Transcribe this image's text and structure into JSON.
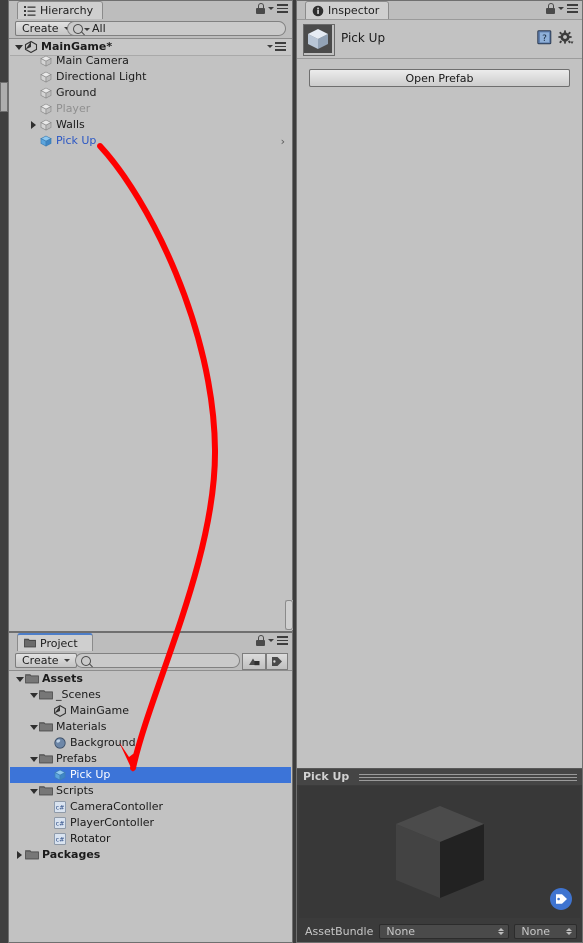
{
  "app": {
    "name": "Unity Editor",
    "accent": "#3c74d8",
    "annotation_color": "#fe0000"
  },
  "hierarchy": {
    "tab_label": "Hierarchy",
    "tab_icon": "hierarchy-icon",
    "create_label": "Create",
    "search_value": "All",
    "search_placeholder": "",
    "scene": {
      "name": "MainGame*",
      "icon": "unity-scene-icon",
      "expanded": true
    },
    "items": [
      {
        "label": "Main Camera",
        "icon": "gameobject-icon",
        "indent": 1,
        "expandable": false,
        "expanded": false,
        "state": "normal",
        "selected": false,
        "has_chevron": false
      },
      {
        "label": "Directional Light",
        "icon": "gameobject-icon",
        "indent": 1,
        "expandable": false,
        "expanded": false,
        "state": "normal",
        "selected": false,
        "has_chevron": false
      },
      {
        "label": "Ground",
        "icon": "gameobject-icon",
        "indent": 1,
        "expandable": false,
        "expanded": false,
        "state": "normal",
        "selected": false,
        "has_chevron": false
      },
      {
        "label": "Player",
        "icon": "gameobject-icon",
        "indent": 1,
        "expandable": false,
        "expanded": false,
        "state": "disabled",
        "selected": false,
        "has_chevron": false
      },
      {
        "label": "Walls",
        "icon": "gameobject-icon",
        "indent": 1,
        "expandable": true,
        "expanded": false,
        "state": "normal",
        "selected": false,
        "has_chevron": false
      },
      {
        "label": "Pick Up",
        "icon": "prefab-icon",
        "indent": 1,
        "expandable": false,
        "expanded": false,
        "state": "prefab",
        "selected": false,
        "has_chevron": true
      }
    ]
  },
  "inspector": {
    "tab_label": "Inspector",
    "tab_icon": "info-icon",
    "object_name": "Pick Up",
    "object_icon": "prefab-cube-thumbnail",
    "help_icon": "help-book-icon",
    "settings_icon": "gear-icon",
    "open_prefab_label": "Open Prefab"
  },
  "project": {
    "tab_label": "Project",
    "tab_icon": "folder-icon",
    "create_label": "Create",
    "search_value": "",
    "search_placeholder": "",
    "filter_type_icon": "filter-by-type-icon",
    "filter_label_icon": "filter-by-label-icon",
    "items": [
      {
        "label": "Assets",
        "icon": "folder-icon",
        "indent": 0,
        "expandable": true,
        "expanded": true,
        "bold": true,
        "selected": false
      },
      {
        "label": "_Scenes",
        "icon": "folder-icon",
        "indent": 1,
        "expandable": true,
        "expanded": true,
        "bold": false,
        "selected": false
      },
      {
        "label": "MainGame",
        "icon": "scene-icon",
        "indent": 2,
        "expandable": false,
        "expanded": false,
        "bold": false,
        "selected": false
      },
      {
        "label": "Materials",
        "icon": "folder-icon",
        "indent": 1,
        "expandable": true,
        "expanded": true,
        "bold": false,
        "selected": false
      },
      {
        "label": "Background",
        "icon": "material-icon",
        "indent": 2,
        "expandable": false,
        "expanded": false,
        "bold": false,
        "selected": false
      },
      {
        "label": "Prefabs",
        "icon": "folder-icon",
        "indent": 1,
        "expandable": true,
        "expanded": true,
        "bold": false,
        "selected": false
      },
      {
        "label": "Pick Up",
        "icon": "prefab-icon",
        "indent": 2,
        "expandable": false,
        "expanded": false,
        "bold": false,
        "selected": true
      },
      {
        "label": "Scripts",
        "icon": "folder-icon",
        "indent": 1,
        "expandable": true,
        "expanded": true,
        "bold": false,
        "selected": false
      },
      {
        "label": "CameraContoller",
        "icon": "csharp-script-icon",
        "indent": 2,
        "expandable": false,
        "expanded": false,
        "bold": false,
        "selected": false
      },
      {
        "label": "PlayerContoller",
        "icon": "csharp-script-icon",
        "indent": 2,
        "expandable": false,
        "expanded": false,
        "bold": false,
        "selected": false
      },
      {
        "label": "Rotator",
        "icon": "csharp-script-icon",
        "indent": 2,
        "expandable": false,
        "expanded": false,
        "bold": false,
        "selected": false
      },
      {
        "label": "Packages",
        "icon": "folder-icon",
        "indent": 0,
        "expandable": true,
        "expanded": false,
        "bold": true,
        "selected": false
      }
    ]
  },
  "preview": {
    "title": "Pick Up",
    "model": "cube-3d-preview",
    "tag_icon": "tag-icon",
    "assetbundle_label": "AssetBundle",
    "assetbundle_value": "None",
    "assetbundle_variant_value": "None"
  }
}
